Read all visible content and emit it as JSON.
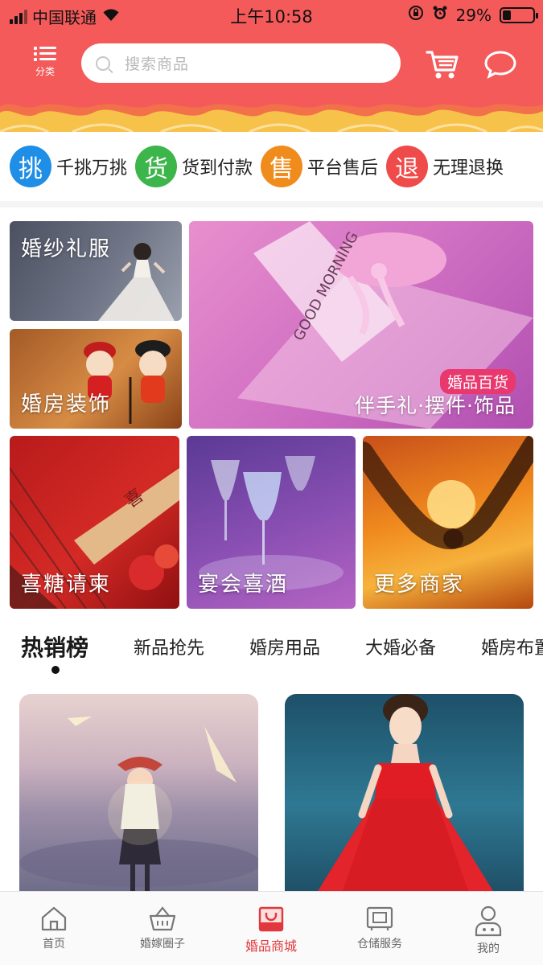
{
  "status_bar": {
    "carrier": "中国联通",
    "time": "上午10:58",
    "battery_percent": "29%",
    "battery_level": 0.29,
    "icons": [
      "signal-icon",
      "wifi-icon",
      "orientation-lock-icon",
      "alarm-icon",
      "battery-icon"
    ]
  },
  "header": {
    "category_label": "分类",
    "search_placeholder": "搜索商品",
    "icons": [
      "menu-list-icon",
      "search-icon",
      "cart-icon",
      "message-icon"
    ]
  },
  "services": [
    {
      "glyph": "挑",
      "label": "千挑万挑",
      "color": "#1e8ee6"
    },
    {
      "glyph": "货",
      "label": "货到付款",
      "color": "#3cb54a"
    },
    {
      "glyph": "售",
      "label": "平台售后",
      "color": "#f08c1c"
    },
    {
      "glyph": "退",
      "label": "无理退换",
      "color": "#ef4b4b"
    }
  ],
  "categories": {
    "gown": "婚纱礼服",
    "decor": "婚房装饰",
    "gifts_badge": "婚品百货",
    "gifts_sub": "伴手礼·摆件·饰品",
    "candy": "喜糖请柬",
    "wine": "宴会喜酒",
    "more": "更多商家"
  },
  "tabs": [
    {
      "label": "热销榜",
      "active": true
    },
    {
      "label": "新品抢先",
      "active": false
    },
    {
      "label": "婚房用品",
      "active": false
    },
    {
      "label": "大婚必备",
      "active": false
    },
    {
      "label": "婚房布置",
      "active": false
    }
  ],
  "bottom_nav": [
    {
      "label": "首页",
      "icon": "home-icon",
      "active": false
    },
    {
      "label": "婚嫁圈子",
      "icon": "basket-icon",
      "active": false
    },
    {
      "label": "婚品商城",
      "icon": "shopping-bag-icon",
      "active": true
    },
    {
      "label": "仓储服务",
      "icon": "storage-icon",
      "active": false
    },
    {
      "label": "我的",
      "icon": "profile-icon",
      "active": false
    }
  ],
  "colors": {
    "brand_red": "#f45a5a",
    "active_nav": "#e0383c",
    "festive_yellow": "#f6c24a"
  }
}
